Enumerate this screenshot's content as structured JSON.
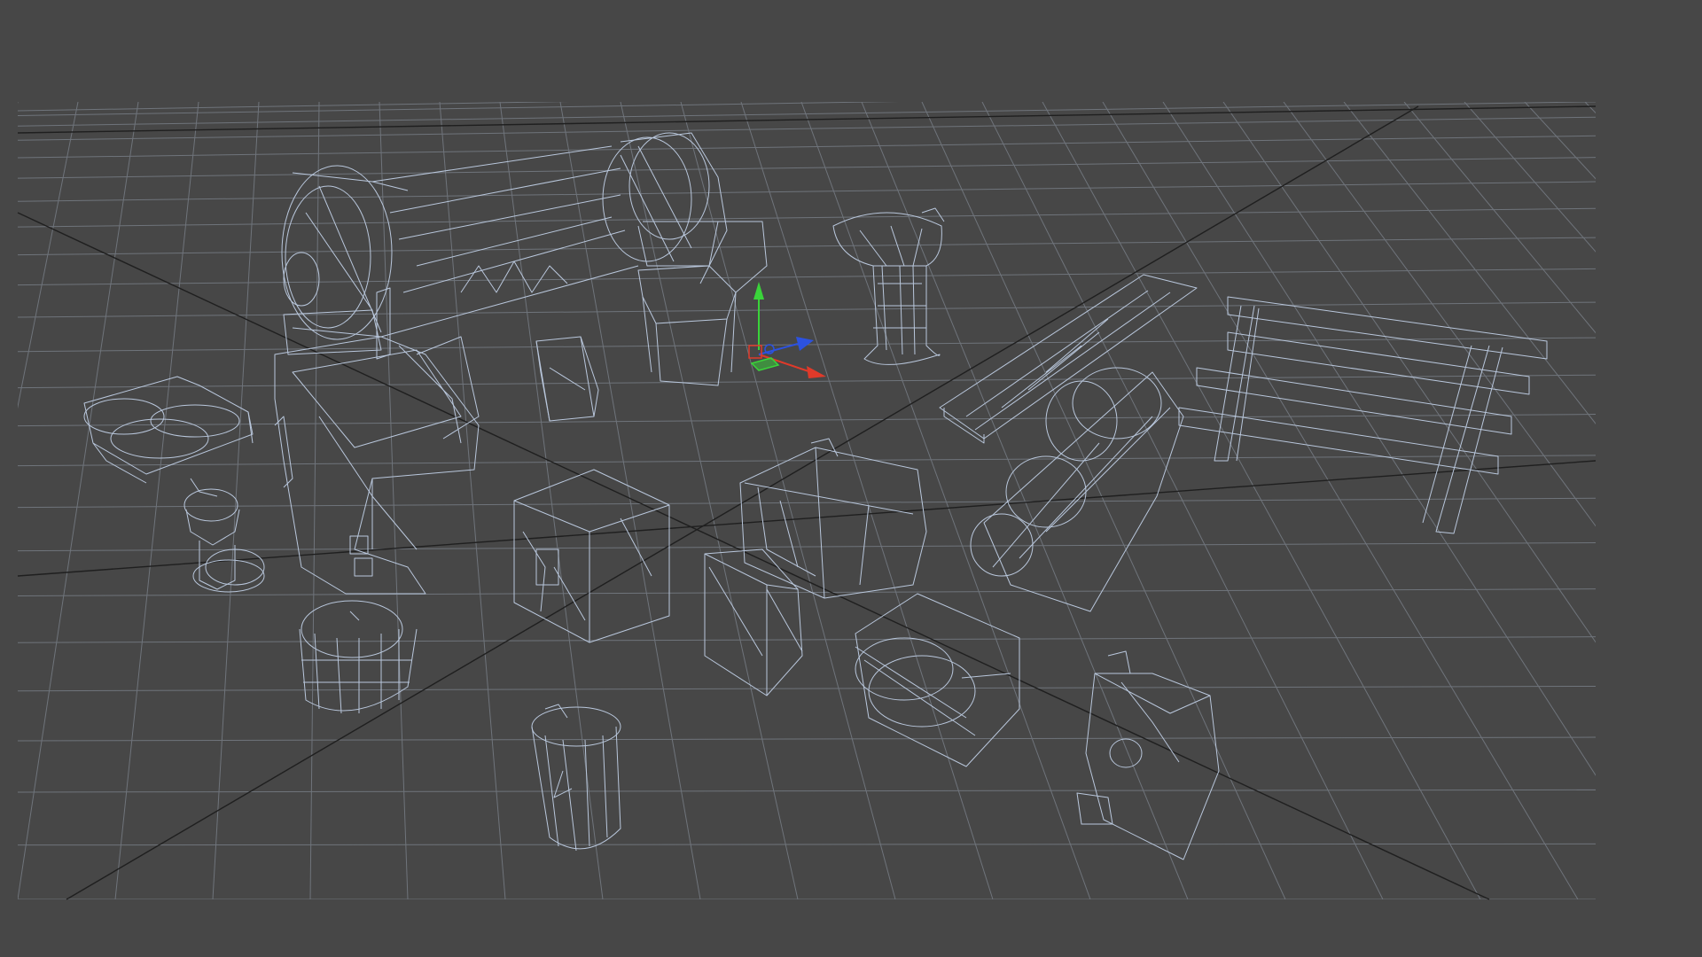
{
  "viewport": {
    "background_color": "#474747",
    "grid_color": "#6f747b",
    "axis_line_color": "#1f1f1f",
    "wireframe_color": "#b9c7dc",
    "gizmo": {
      "x_axis_color": "#e03a2a",
      "y_axis_color": "#3ad43a",
      "z_axis_color": "#2c52e0",
      "plane_handle_xz_color": "#3ad43a",
      "plane_handle_xy_color": "#e03a2a"
    },
    "objects": [
      "cannon-barrel",
      "cannon-carriage",
      "capstan",
      "ladder",
      "fence-railing",
      "rolled-log-bundle",
      "spindle-post",
      "barrel",
      "cylindrical-canister",
      "crate-large",
      "crate-small",
      "table-block",
      "wood-log",
      "lantern-box",
      "pillar-support",
      "sack-bundle",
      "small-block",
      "hexagon-stand"
    ]
  }
}
